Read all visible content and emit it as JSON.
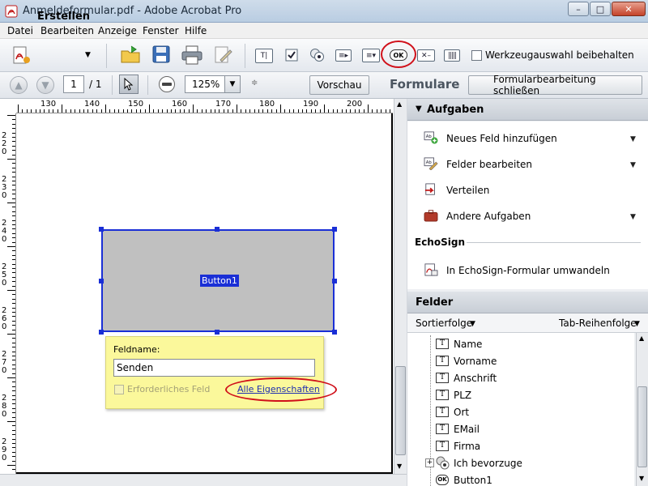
{
  "window": {
    "title": "Anmeldeformular.pdf - Adobe Acrobat Pro",
    "minimize_label": "–",
    "maximize_label": "□",
    "close_label": "✕"
  },
  "menu": [
    "Datei",
    "Bearbeiten",
    "Anzeige",
    "Fenster",
    "Hilfe"
  ],
  "toolbar": {
    "create_label": "Erstellen",
    "ok_tool_label": "OK",
    "keep_tool_label": "Werkzeugauswahl beibehalten"
  },
  "nav": {
    "page_current": "1",
    "page_total": "/   1",
    "zoom_value": "125%",
    "preview_label": "Vorschau",
    "mode_label": "Formulare",
    "close_edit_label": "Formularbearbeitung schließen"
  },
  "rulers": {
    "top": [
      "130",
      "140",
      "150",
      "160",
      "170",
      "180",
      "190",
      "200"
    ],
    "left": [
      "2 2 0",
      "2 3 0",
      "2 4 0",
      "2 5 0",
      "2 6 0",
      "2 7 0",
      "2 8 0",
      "2 9 0"
    ]
  },
  "document": {
    "button_field_label": "Button1",
    "popup": {
      "field_name_label": "Feldname:",
      "field_name_value": "Senden",
      "required_label": "Erforderliches Feld",
      "all_properties_link": "Alle Eigenschaften"
    }
  },
  "tasks_panel": {
    "header": "Aufgaben",
    "items": [
      {
        "label": "Neues Feld hinzufügen",
        "has_menu": true
      },
      {
        "label": "Felder bearbeiten",
        "has_menu": true
      },
      {
        "label": "Verteilen",
        "has_menu": false
      },
      {
        "label": "Andere Aufgaben",
        "has_menu": true
      }
    ],
    "echosign_header": "EchoSign",
    "echosign_item": "In EchoSign-Formular umwandeln"
  },
  "fields_panel": {
    "header": "Felder",
    "sort_label": "Sortierfolge",
    "tab_order_label": "Tab-Reihenfolge",
    "items": [
      {
        "label": "Name",
        "icon": "T"
      },
      {
        "label": "Vorname",
        "icon": "T"
      },
      {
        "label": "Anschrift",
        "icon": "T"
      },
      {
        "label": "PLZ",
        "icon": "T"
      },
      {
        "label": "Ort",
        "icon": "T"
      },
      {
        "label": "EMail",
        "icon": "T"
      },
      {
        "label": "Firma",
        "icon": "T"
      },
      {
        "label": "Ich bevorzuge",
        "icon": "radio"
      },
      {
        "label": "Button1",
        "icon": "OK"
      }
    ]
  },
  "colors": {
    "selection_blue": "#1a2fd6",
    "highlight_red": "#d0101a",
    "popup_yellow": "#fbf89b"
  }
}
